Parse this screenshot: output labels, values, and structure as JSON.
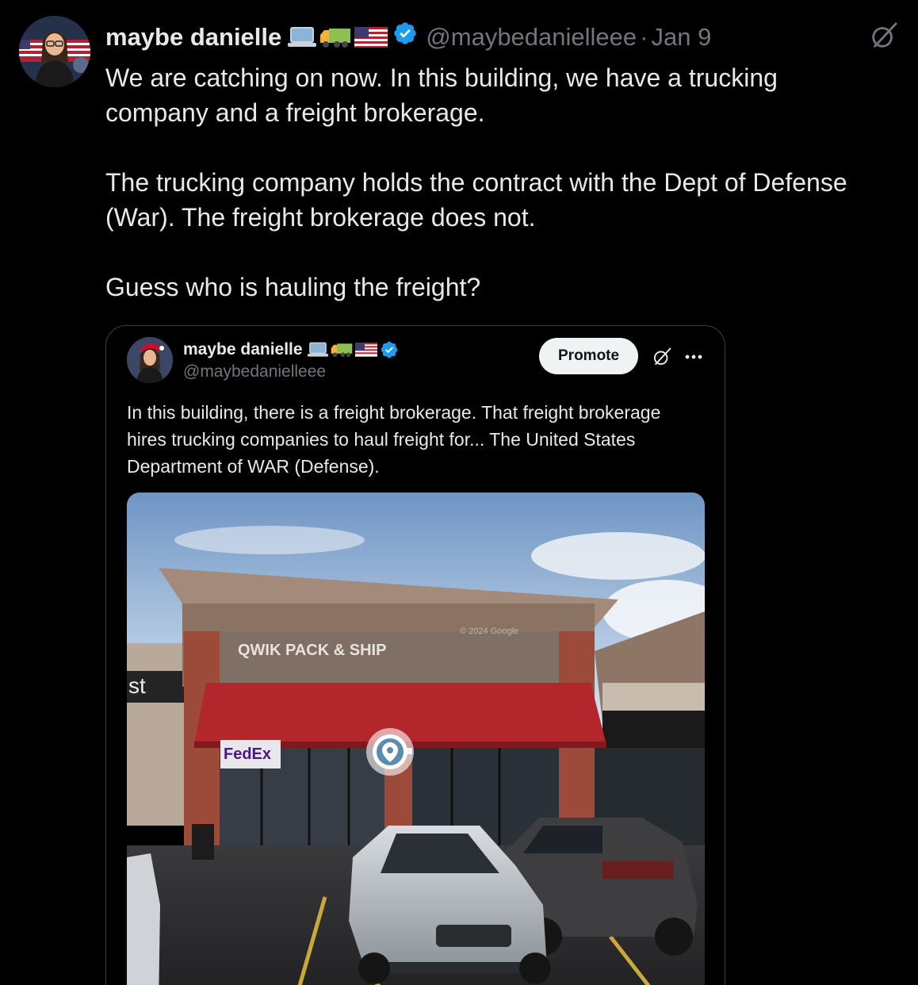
{
  "tweet": {
    "display_name": "maybe danielle",
    "handle": "@maybedanielleee",
    "separator": "·",
    "date": "Jan 9",
    "name_emojis": [
      "laptop-emoji",
      "truck-emoji",
      "us-flag-emoji"
    ],
    "verified_icon": "verified-badge-icon",
    "grok_icon": "grok-icon",
    "paragraphs": [
      "We are catching on now. In this building, we have a trucking company and a freight brokerage.",
      "The trucking company holds the contract with the Dept of Defense (War). The freight brokerage does not.",
      "Guess who is hauling the freight?"
    ]
  },
  "quoted_tweet": {
    "display_name": "maybe danielle",
    "handle": "@maybedanielleee",
    "promote_label": "Promote",
    "more_icon": "more-dots-icon",
    "text": "In this building, there is a freight brokerage. That freight brokerage hires trucking companies to haul freight for... The United States Department of WAR (Defense).",
    "photo": {
      "store_sign": "QWIK PACK & SHIP",
      "fedex_sign": "FedEx",
      "partial_sign": "st",
      "watermark": "© 2024 Google",
      "location_pin_icon": "location-pin-icon"
    }
  },
  "colors": {
    "background": "#000000",
    "primary_text": "#e7e9ea",
    "secondary_text": "#71767b",
    "verified_blue": "#1d9bf0",
    "card_border": "#3a3d41",
    "awning_red": "#b3262b"
  }
}
